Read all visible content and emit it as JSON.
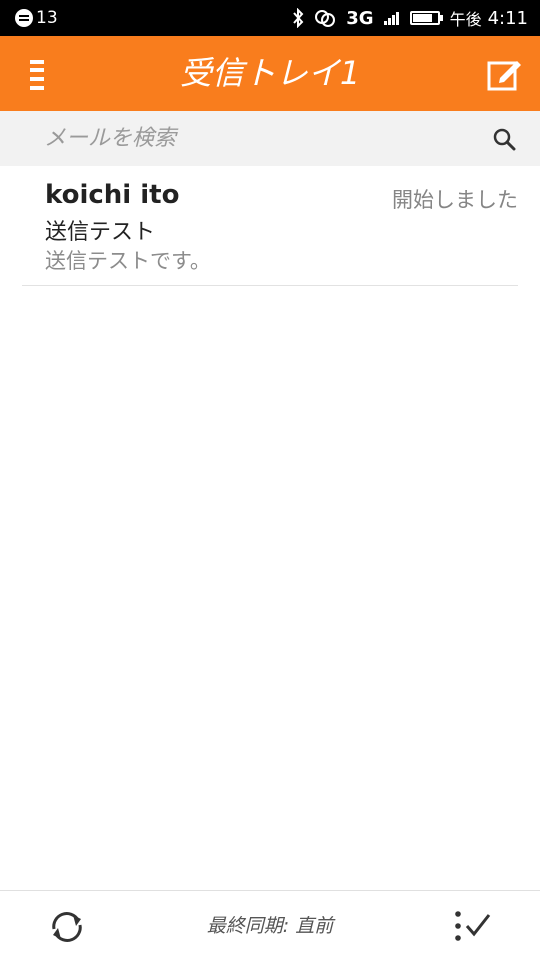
{
  "status_bar": {
    "notification_count": "13",
    "network_label": "3G",
    "time_prefix": "午後",
    "time": "4:11",
    "icons": [
      "notification-icon",
      "bluetooth-icon",
      "link-icon",
      "signal-icon",
      "battery-icon"
    ]
  },
  "header": {
    "title": "受信トレイ1",
    "menu_icon": "hamburger-menu-icon",
    "compose_icon": "compose-icon",
    "accent_color": "#f97d1d"
  },
  "search": {
    "placeholder": "メールを検索",
    "icon": "search-icon"
  },
  "messages": [
    {
      "sender": "koichi ito",
      "date": "開始しました",
      "subject": "送信テスト",
      "snippet": "送信テストです。"
    }
  ],
  "footer": {
    "sync_status": "最終同期: 直前",
    "refresh_icon": "refresh-icon",
    "edit_icon": "edit-mode-icon"
  }
}
